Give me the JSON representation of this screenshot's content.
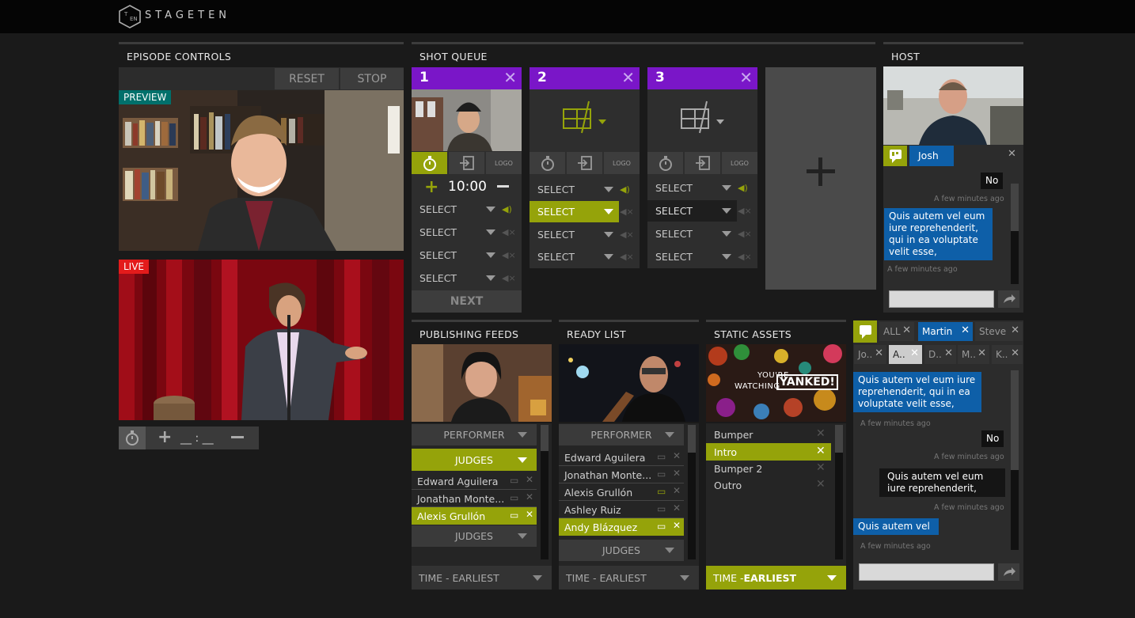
{
  "brand": {
    "name": "STAGETEN"
  },
  "colors": {
    "live": "#e31b1b",
    "preview": "#00706b",
    "accent_purple": "#7a16c8",
    "accent_green": "#95a30a",
    "chat_blue": "#0e5fa8"
  },
  "episode_controls": {
    "title": "EPISODE CONTROLS",
    "reset_label": "RESET",
    "stop_label": "STOP",
    "preview_label": "PREVIEW",
    "live_label": "LIVE",
    "timer_placeholder": "__ : __"
  },
  "shot_queue": {
    "title": "SHOT QUEUE",
    "cards": [
      {
        "number": "1",
        "logo": "LOGO",
        "time": "10:00",
        "selects": [
          "SELECT",
          "SELECT",
          "SELECT",
          "SELECT"
        ],
        "next_label": "NEXT"
      },
      {
        "number": "2",
        "logo": "LOGO",
        "selects": [
          "SELECT",
          "SELECT",
          "SELECT",
          "SELECT"
        ]
      },
      {
        "number": "3",
        "logo": "LOGO",
        "selects": [
          "SELECT",
          "SELECT",
          "SELECT",
          "SELECT"
        ]
      }
    ]
  },
  "host": {
    "title": "HOST",
    "chat_name": "Josh",
    "messages": [
      {
        "text": "No",
        "meta": "A few minutes ago"
      },
      {
        "text": "Quis autem vel eum iure reprehenderit, qui in ea voluptate velit esse,",
        "meta": "A few minutes ago"
      }
    ]
  },
  "publishing_feeds": {
    "title": "PUBLISHING FEEDS",
    "dropdown_top": "PERFORMER",
    "dropdown_active": "JUDGES",
    "items": [
      "Edward Aguilera",
      "Jonathan Monte...",
      "Alexis Grullón"
    ],
    "dropdown_bottom": "JUDGES",
    "sort": "TIME - EARLIEST"
  },
  "ready_list": {
    "title": "READY LIST",
    "dropdown_top": "PERFORMER",
    "items": [
      "Edward Aguilera",
      "Jonathan Monte...",
      "Alexis Grullón",
      "Ashley Ruiz",
      "Andy Blázquez"
    ],
    "dropdown_bottom": "JUDGES",
    "sort": "TIME - EARLIEST"
  },
  "static_assets": {
    "title": "STATIC ASSETS",
    "thumb_line1": "YOU'RE",
    "thumb_line2": "WATCHING",
    "thumb_line3": "YANKED!",
    "items": [
      "Bumper",
      "Intro",
      "Bumper 2",
      "Outro"
    ],
    "sort_prefix": "TIME - ",
    "sort_value": "EARLIEST"
  },
  "chat": {
    "tabs_row1": [
      "ALL",
      "Martin",
      "Steve"
    ],
    "tabs_row2": [
      "Jo..",
      "A..",
      "D..",
      "M..",
      "K.."
    ],
    "messages": [
      {
        "text": "Quis autem vel eum iure reprehenderit, qui in ea voluptate velit esse,",
        "meta": "A few minutes ago"
      },
      {
        "text": "No",
        "meta": "A few minutes ago"
      },
      {
        "text": "Quis autem vel eum iure reprehenderit,",
        "meta": "A few minutes ago"
      },
      {
        "text": "Quis autem vel",
        "meta": "A few minutes ago"
      }
    ]
  }
}
